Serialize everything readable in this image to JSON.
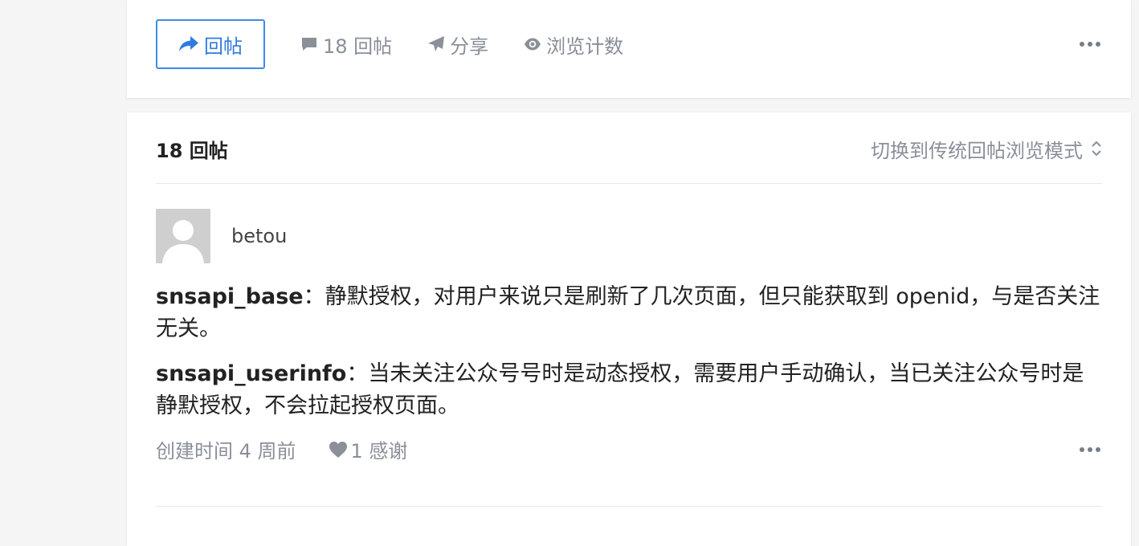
{
  "top_card": {
    "reply_label": "回帖",
    "comment_count_label": "18 回帖",
    "share_label": "分享",
    "views_label": "浏览计数"
  },
  "replies": {
    "count_label": "18 回帖",
    "switch_mode_label": "切换到传统回帖浏览模式"
  },
  "post": {
    "author": "betou",
    "paragraphs": [
      {
        "term": "snsapi_base",
        "text": "：静默授权，对用户来说只是刷新了几次页面，但只能获取到 openid，与是否关注无关。"
      },
      {
        "term": "snsapi_userinfo",
        "text": "：当未关注公众号号时是动态授权，需要用户手动确认，当已关注公众号时是静默授权，不会拉起授权页面。"
      }
    ],
    "created_label": "创建时间 4 周前",
    "thanks_label": "1 感谢"
  },
  "colors": {
    "accent": "#3c8ce6",
    "muted": "#8a8f98",
    "page_bg": "#f5f5f5"
  },
  "icons": {
    "reply": "reply-arrow-icon",
    "comment": "comment-bubble-icon",
    "share": "paper-plane-icon",
    "views": "eye-icon",
    "sort": "sort-updown-icon",
    "thanks": "heart-icon",
    "more": "ellipsis-icon"
  }
}
